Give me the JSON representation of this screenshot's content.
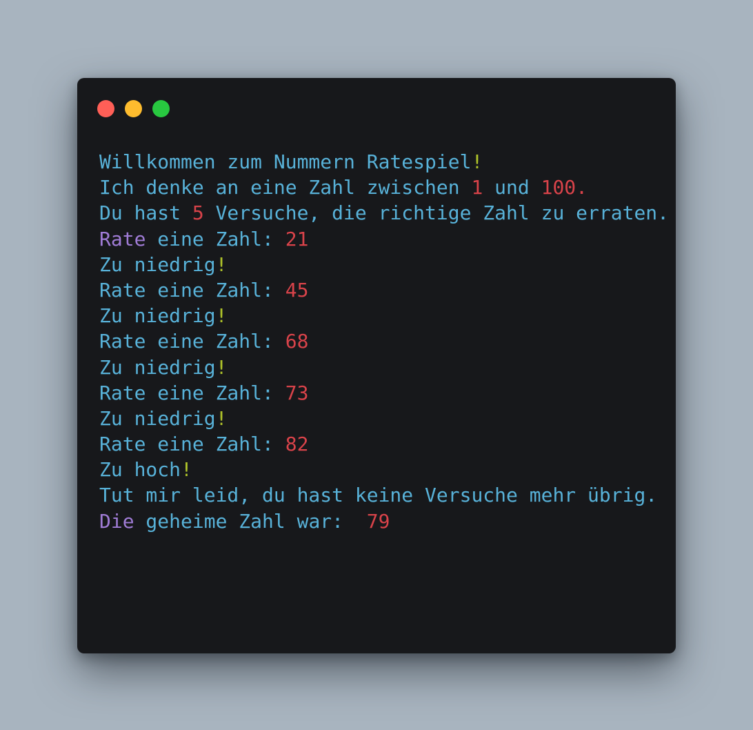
{
  "window": {
    "controls": [
      {
        "name": "close-button",
        "color": "#ff5f57"
      },
      {
        "name": "minimize-button",
        "color": "#febc2e"
      },
      {
        "name": "maximize-button",
        "color": "#28c840"
      }
    ]
  },
  "terminal": {
    "colors": {
      "text": "#58b2d9",
      "number": "#d9434a",
      "exclamation": "#b0c42a",
      "keyword": "#a07cd6"
    },
    "lines": [
      [
        {
          "t": "Willkommen zum Nummern Ratespiel",
          "c": "txt"
        },
        {
          "t": "!",
          "c": "bang"
        }
      ],
      [
        {
          "t": "Ich denke an eine Zahl zwischen ",
          "c": "txt"
        },
        {
          "t": "1",
          "c": "num"
        },
        {
          "t": " und ",
          "c": "txt"
        },
        {
          "t": "100.",
          "c": "num"
        }
      ],
      [
        {
          "t": "Du hast ",
          "c": "txt"
        },
        {
          "t": "5",
          "c": "num"
        },
        {
          "t": " Versuche, die richtige Zahl zu erraten.",
          "c": "txt"
        }
      ],
      [
        {
          "t": "Rate",
          "c": "kw"
        },
        {
          "t": " eine Zahl: ",
          "c": "txt"
        },
        {
          "t": "21",
          "c": "num"
        }
      ],
      [
        {
          "t": "Zu niedrig",
          "c": "txt"
        },
        {
          "t": "!",
          "c": "bang"
        }
      ],
      [
        {
          "t": "Rate eine Zahl: ",
          "c": "txt"
        },
        {
          "t": "45",
          "c": "num"
        }
      ],
      [
        {
          "t": "Zu niedrig",
          "c": "txt"
        },
        {
          "t": "!",
          "c": "bang"
        }
      ],
      [
        {
          "t": "Rate eine Zahl: ",
          "c": "txt"
        },
        {
          "t": "68",
          "c": "num"
        }
      ],
      [
        {
          "t": "Zu niedrig",
          "c": "txt"
        },
        {
          "t": "!",
          "c": "bang"
        }
      ],
      [
        {
          "t": "Rate eine Zahl: ",
          "c": "txt"
        },
        {
          "t": "73",
          "c": "num"
        }
      ],
      [
        {
          "t": "Zu niedrig",
          "c": "txt"
        },
        {
          "t": "!",
          "c": "bang"
        }
      ],
      [
        {
          "t": "Rate eine Zahl: ",
          "c": "txt"
        },
        {
          "t": "82",
          "c": "num"
        }
      ],
      [
        {
          "t": "Zu hoch",
          "c": "txt"
        },
        {
          "t": "!",
          "c": "bang"
        }
      ],
      [
        {
          "t": "Tut mir leid, du hast keine Versuche mehr übrig.",
          "c": "txt"
        }
      ],
      [
        {
          "t": "Die",
          "c": "kw"
        },
        {
          "t": " geheime Zahl war:  ",
          "c": "txt"
        },
        {
          "t": "79",
          "c": "num"
        }
      ]
    ]
  }
}
